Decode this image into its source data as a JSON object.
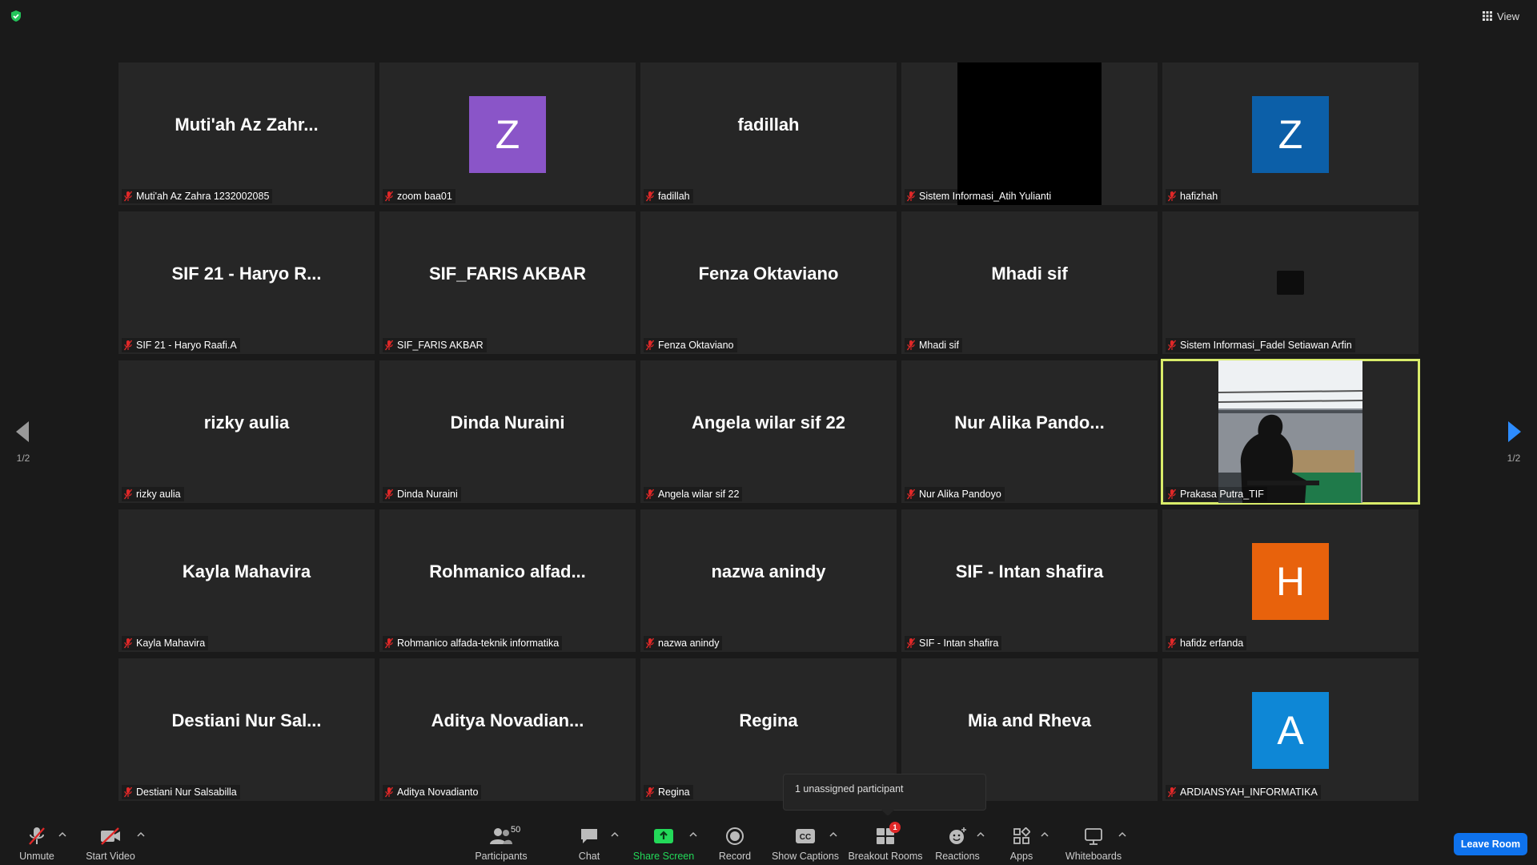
{
  "top_bar": {
    "view_label": "View"
  },
  "pagination": {
    "left_page": "1/2",
    "right_page": "1/2"
  },
  "participants": [
    {
      "display": "Muti'ah Az Zahr...",
      "label": "Muti'ah Az Zahra 1232002085",
      "kind": "name"
    },
    {
      "display": "Z",
      "label": "zoom baa01",
      "kind": "avatar",
      "color": "#8a55c8"
    },
    {
      "display": "fadillah",
      "label": "fadillah",
      "kind": "name"
    },
    {
      "display": "",
      "label": "Sistem Informasi_Atih Yulianti",
      "kind": "black-video"
    },
    {
      "display": "Z",
      "label": "hafizhah",
      "kind": "avatar",
      "color": "#0c5fa8"
    },
    {
      "display": "SIF 21 - Haryo R...",
      "label": "SIF 21 - Haryo Raafi.A",
      "kind": "name"
    },
    {
      "display": "SIF_FARIS AKBAR",
      "label": "SIF_FARIS AKBAR",
      "kind": "name"
    },
    {
      "display": "Fenza Oktaviano",
      "label": "Fenza Oktaviano",
      "kind": "name"
    },
    {
      "display": "Mhadi sif",
      "label": "Mhadi sif",
      "kind": "name"
    },
    {
      "display": "",
      "label": "Sistem Informasi_Fadel Setiawan Arfin",
      "kind": "small-video"
    },
    {
      "display": "rizky aulia",
      "label": "rizky aulia",
      "kind": "name"
    },
    {
      "display": "Dinda Nuraini",
      "label": "Dinda Nuraini",
      "kind": "name"
    },
    {
      "display": "Angela wilar sif 22",
      "label": "Angela wilar sif 22",
      "kind": "name"
    },
    {
      "display": "Nur Alika Pando...",
      "label": "Nur Alika Pandoyo",
      "kind": "name"
    },
    {
      "display": "",
      "label": "Prakasa Putra_TIF",
      "kind": "camera",
      "active": true
    },
    {
      "display": "Kayla Mahavira",
      "label": "Kayla Mahavira",
      "kind": "name"
    },
    {
      "display": "Rohmanico  alfad...",
      "label": "Rohmanico alfada-teknik informatika",
      "kind": "name"
    },
    {
      "display": "nazwa anindy",
      "label": "nazwa anindy",
      "kind": "name"
    },
    {
      "display": "SIF - Intan shafira",
      "label": "SIF - Intan shafira",
      "kind": "name"
    },
    {
      "display": "H",
      "label": "hafidz erfanda",
      "kind": "avatar",
      "color": "#e8620c"
    },
    {
      "display": "Destiani Nur Sal...",
      "label": "Destiani Nur Salsabilla",
      "kind": "name"
    },
    {
      "display": "Aditya  Novadian...",
      "label": "Aditya Novadianto",
      "kind": "name"
    },
    {
      "display": "Regina",
      "label": "Regina",
      "kind": "name"
    },
    {
      "display": "Mia and Rheva",
      "label": "",
      "kind": "name"
    },
    {
      "display": "A",
      "label": "ARDIANSYAH_INFORMATIKA",
      "kind": "avatar",
      "color": "#0e87d6"
    }
  ],
  "tooltip": {
    "text": "1 unassigned participant"
  },
  "toolbar": {
    "unmute": "Unmute",
    "start_video": "Start Video",
    "participants": "Participants",
    "participants_count": "50",
    "chat": "Chat",
    "share_screen": "Share Screen",
    "record": "Record",
    "show_captions": "Show Captions",
    "breakout_rooms": "Breakout Rooms",
    "breakout_badge": "1",
    "reactions": "Reactions",
    "apps": "Apps",
    "whiteboards": "Whiteboards",
    "leave_room": "Leave Room"
  },
  "colors": {
    "active_border": "#d9ec6a",
    "share_green": "#23d959",
    "leave_blue": "#0e72ed",
    "mic_red": "#e02828"
  }
}
